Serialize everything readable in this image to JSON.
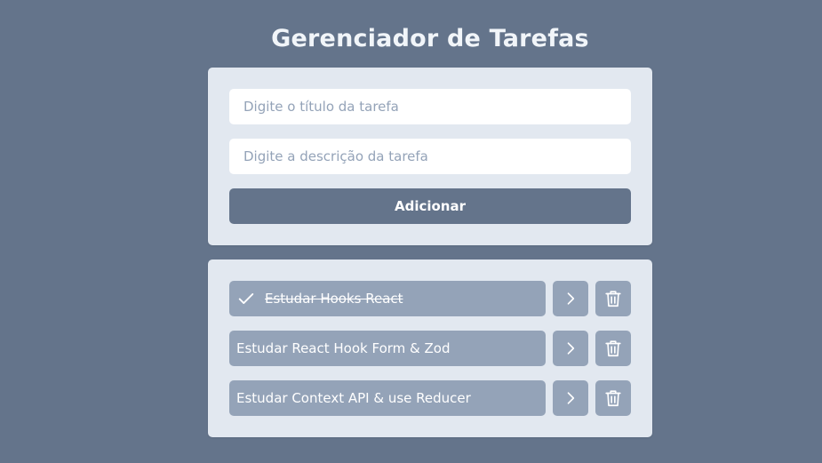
{
  "header": {
    "title": "Gerenciador de Tarefas"
  },
  "form": {
    "title_placeholder": "Digite o título da tarefa",
    "title_value": "",
    "description_placeholder": "Digite a descrição da tarefa",
    "description_value": "",
    "add_label": "Adicionar"
  },
  "tasks": [
    {
      "title": "Estudar Hooks React",
      "completed": true,
      "icons": [
        "check-icon",
        "chevron-right-icon",
        "trash-icon"
      ]
    },
    {
      "title": "Estudar React Hook Form & Zod",
      "completed": false,
      "icons": [
        "chevron-right-icon",
        "trash-icon"
      ]
    },
    {
      "title": "Estudar Context API & use Reducer",
      "completed": false,
      "icons": [
        "chevron-right-icon",
        "trash-icon"
      ]
    }
  ],
  "colors": {
    "background": "#64748b",
    "card": "#e2e8f0",
    "task": "#94a3b8",
    "button": "#64748b",
    "title": "#f1f5f9"
  }
}
